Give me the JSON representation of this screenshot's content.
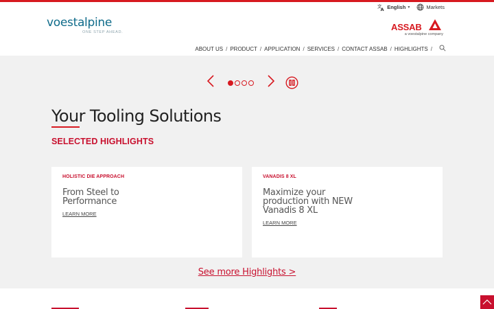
{
  "header": {
    "language": {
      "label": "English",
      "icon": "translate-icon"
    },
    "markets": {
      "label": "Markets",
      "icon": "globe-icon"
    },
    "brand": {
      "name": "voestalpine",
      "tagline": "ONE STEP AHEAD."
    },
    "partner_logo": {
      "name": "ASSAB",
      "sub": "a voestalpine company"
    },
    "nav": [
      {
        "label": "ABOUT US"
      },
      {
        "label": "PRODUCT"
      },
      {
        "label": "APPLICATION"
      },
      {
        "label": "SERVICES"
      },
      {
        "label": "CONTACT ASSAB"
      },
      {
        "label": "HIGHLIGHTS"
      }
    ],
    "nav_separator": "/"
  },
  "carousel": {
    "slide_count": 4,
    "active_index": 0
  },
  "main": {
    "title": "Your Tooling Solutions",
    "section_heading": "SELECTED HIGHLIGHTS",
    "cards": [
      {
        "tag": "HOLISTIC DIE APPROACH",
        "title": "From Steel to Performance",
        "link": "LEARN MORE"
      },
      {
        "tag": "VANADIS 8 XL",
        "title": "Maximize your production with NEW Vanadis 8 XL",
        "link": "LEARN MORE"
      }
    ],
    "see_more": "See more Highlights >"
  },
  "colors": {
    "accent": "#c8102e",
    "brand_blue": "#0f6b8a",
    "page_bg": "#f1f1f1"
  }
}
